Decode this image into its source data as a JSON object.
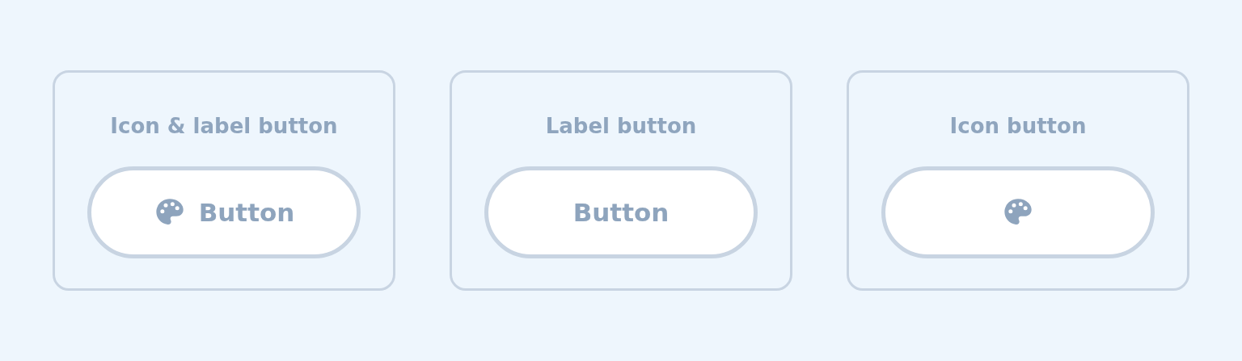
{
  "cards": [
    {
      "kind": "icon_label",
      "title": "Icon & label button",
      "button_label": "Button"
    },
    {
      "kind": "label",
      "title": "Label button",
      "button_label": "Button"
    },
    {
      "kind": "icon",
      "title": "Icon button"
    }
  ]
}
